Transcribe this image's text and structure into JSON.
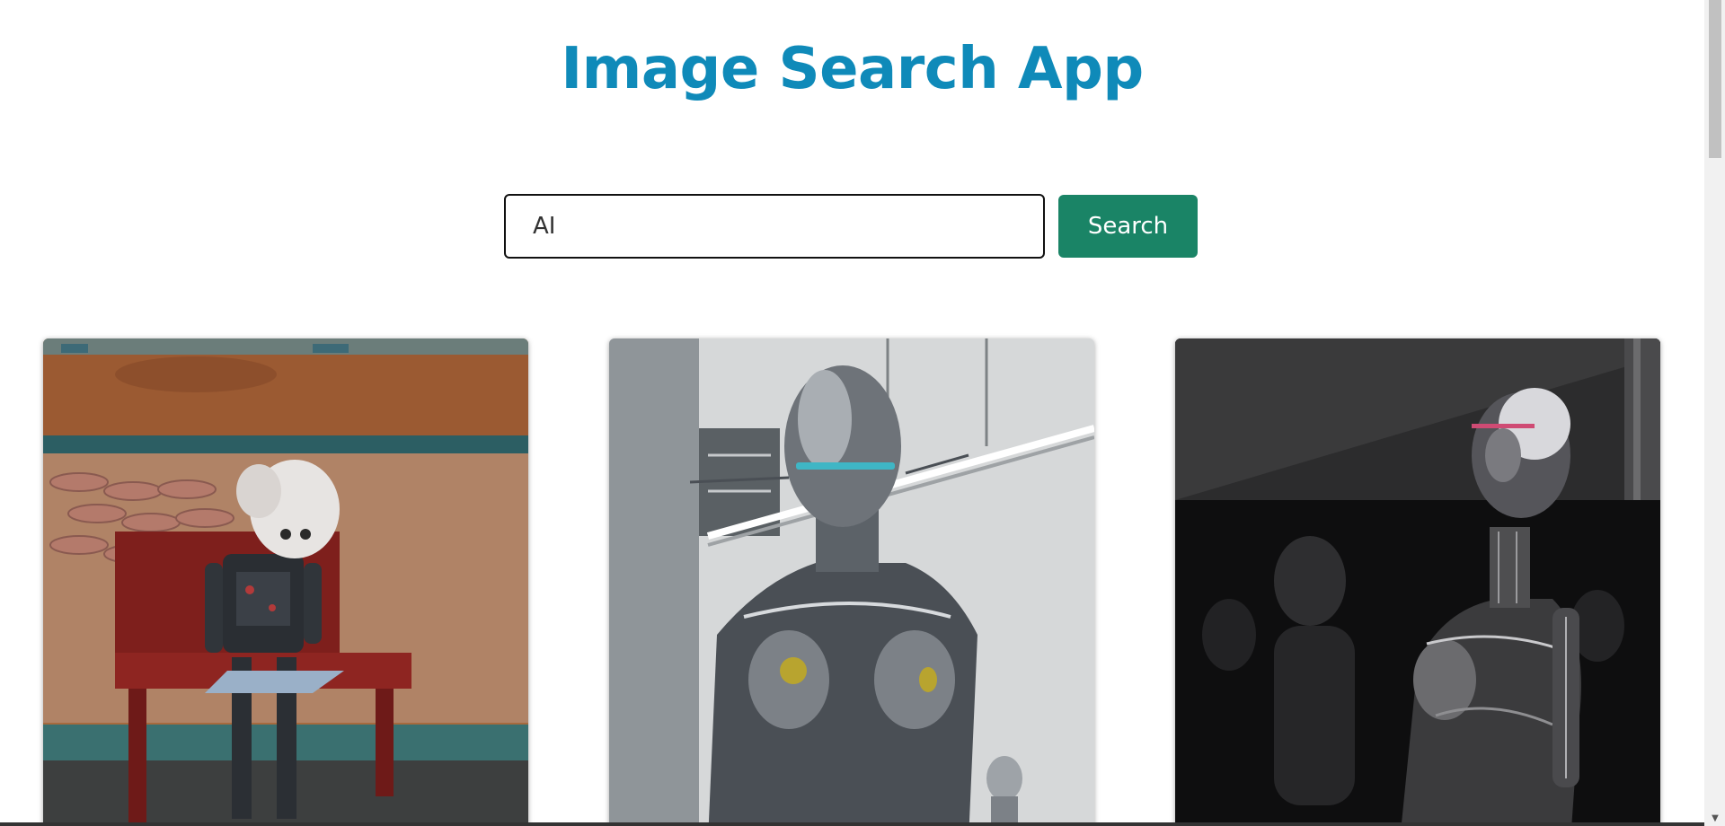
{
  "header": {
    "title": "Image Search App"
  },
  "search": {
    "value": "AI",
    "button_label": "Search"
  },
  "results": [
    {
      "name": "robot-child-reading-on-bench"
    },
    {
      "name": "chrome-female-robot-sculpture"
    },
    {
      "name": "chrome-robot-dark-reflection"
    }
  ],
  "colors": {
    "title": "#0f8ab9",
    "button": "#1a8466"
  }
}
